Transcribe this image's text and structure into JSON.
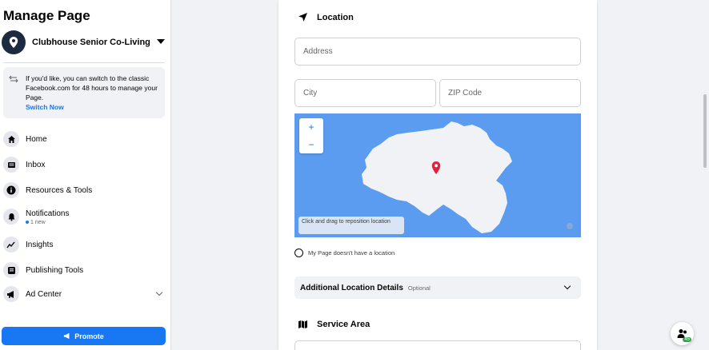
{
  "sidebar": {
    "title": "Manage Page",
    "page_name": "Clubhouse Senior Co-Living",
    "notice": {
      "text": "If you'd like, you can switch to the classic Facebook.com for 48 hours to manage your Page.",
      "link": "Switch Now"
    },
    "items": [
      {
        "label": "Home",
        "icon": "home-icon"
      },
      {
        "label": "Inbox",
        "icon": "inbox-icon"
      },
      {
        "label": "Resources & Tools",
        "icon": "info-icon"
      },
      {
        "label": "Notifications",
        "icon": "bell-icon",
        "sub": "1 new"
      },
      {
        "label": "Insights",
        "icon": "insights-icon"
      },
      {
        "label": "Publishing Tools",
        "icon": "publishing-icon"
      },
      {
        "label": "Ad Center",
        "icon": "megaphone-icon"
      }
    ],
    "promote_label": "Promote"
  },
  "location": {
    "title": "Location",
    "address_placeholder": "Address",
    "city_placeholder": "City",
    "zip_placeholder": "ZIP Code",
    "map": {
      "zoom_in": "+",
      "zoom_out": "−",
      "hint": "Click and drag to reposition location"
    },
    "no_location_label": "My Page doesn't have a location",
    "additional_title": "Additional Location Details",
    "additional_optional": "Optional"
  },
  "service_area": {
    "title": "Service Area"
  },
  "fab": {
    "badge": "45"
  },
  "colors": {
    "accent": "#1877f2",
    "map_water": "#5b9cf0",
    "pin": "#e41e3f"
  }
}
